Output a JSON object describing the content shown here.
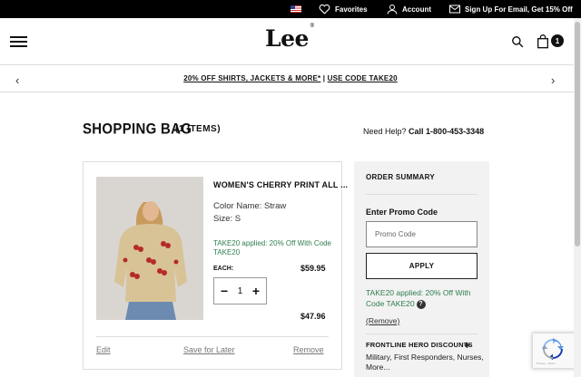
{
  "utility_bar": {
    "favorites": "Favorites",
    "account": "Account",
    "signup": "Sign Up For Email, Get 15% Off"
  },
  "header": {
    "logo": "Lee",
    "logo_mark": "®",
    "bag_count": "1"
  },
  "promo_banner": {
    "offer": "20% OFF SHIRTS, JACKETS & MORE*",
    "separator": "|",
    "code": "USE CODE TAKE20"
  },
  "page": {
    "title": "SHOPPING BAG",
    "items_count": "(1 ITEMS)",
    "help_label": "Need Help?",
    "help_phone": "Call 1-800-453-3348"
  },
  "cart_item": {
    "name": "WOMEN'S CHERRY PRINT ALL ...",
    "color": "Color Name: Straw",
    "size": "Size: S",
    "promo": "TAKE20 applied: 20% Off With Code TAKE20",
    "each_label": "EACH:",
    "each_price": "$59.95",
    "quantity": "1",
    "total_price": "$47.96",
    "edit": "Edit",
    "save_for_later": "Save for Later",
    "remove": "Remove"
  },
  "order_summary": {
    "title": "ORDER SUMMARY",
    "promo_label": "Enter Promo Code",
    "promo_placeholder": "Promo Code",
    "apply": "APPLY",
    "applied_text": "TAKE20 applied: 20% Off With Code TAKE20",
    "remove": "(Remove)",
    "frontline_title": "FRONTLINE HERO DISCOUNTS",
    "frontline_desc": "Military, First Responders, Nurses, More..."
  },
  "colors": {
    "promo_green": "#2e7d4f",
    "topbar_black": "#000000",
    "summary_bg": "#f2f2f2"
  },
  "icons": [
    "us-flag-icon",
    "heart-icon",
    "user-icon",
    "mail-icon",
    "menu-icon",
    "search-icon",
    "bag-icon",
    "chevron-left-icon",
    "chevron-right-icon",
    "minus-icon",
    "plus-icon",
    "help-icon",
    "recaptcha-icon"
  ]
}
